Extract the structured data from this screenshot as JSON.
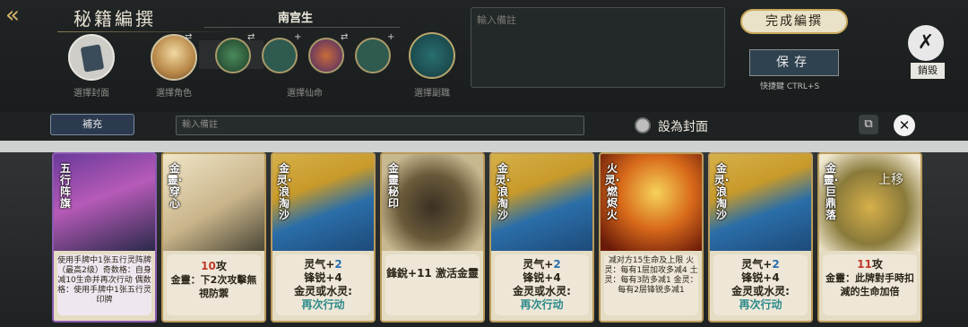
{
  "header": {
    "title": "秘籍編撰",
    "sect_name": "南宫生",
    "slots": {
      "cover_label": "選擇封面",
      "character_label": "選擇角色",
      "fate_label": "選擇仙命",
      "sub_label": "選擇副職"
    },
    "note_placeholder": "輸入備註",
    "finish_label": "完成編撰",
    "save_label": "保存",
    "shortcut": "快捷鍵 CTRL+S",
    "destroy_label": "銷毀"
  },
  "toolbar": {
    "supplement_label": "補充",
    "note_placeholder": "輸入備註",
    "cover_toggle_label": "設為封面"
  },
  "cards": [
    {
      "name": "五行阵旗",
      "text": "使用手牌中1张五行灵阵牌（最高2级）奇数格：自身减10生命并再次行动 偶数格：使用手牌中1张五行灵印牌"
    },
    {
      "name": "金靈·穿心",
      "text_parts": [
        "10",
        "攻",
        "金靈：下2次攻擊無視防禦"
      ]
    },
    {
      "name": "金灵·浪淘沙",
      "text_parts": [
        "灵气+",
        "2",
        "锋锐+4",
        "金灵或水灵:",
        "再次行动"
      ]
    },
    {
      "name": "金靈秘印",
      "text": "鋒銳+11 激活金靈"
    },
    {
      "name": "金灵·浪淘沙",
      "text_parts": [
        "灵气+",
        "2",
        "锋锐+4",
        "金灵或水灵:",
        "再次行动"
      ]
    },
    {
      "name": "火灵·燃烬火",
      "text": "减对方15生命及上限 火灵：每有1层加攻多减4 土灵：每有3防多减1 金灵：每有2层锋锐多减1"
    },
    {
      "name": "金灵·浪淘沙",
      "text_parts": [
        "灵气+",
        "2",
        "锋锐+4",
        "金灵或水灵:",
        "再次行动"
      ]
    },
    {
      "name": "金靈·巨鼎落",
      "text_parts": [
        "11",
        "攻",
        "金靈：此牌對手時扣減的生命加倍"
      ]
    }
  ],
  "float_label": "上移"
}
